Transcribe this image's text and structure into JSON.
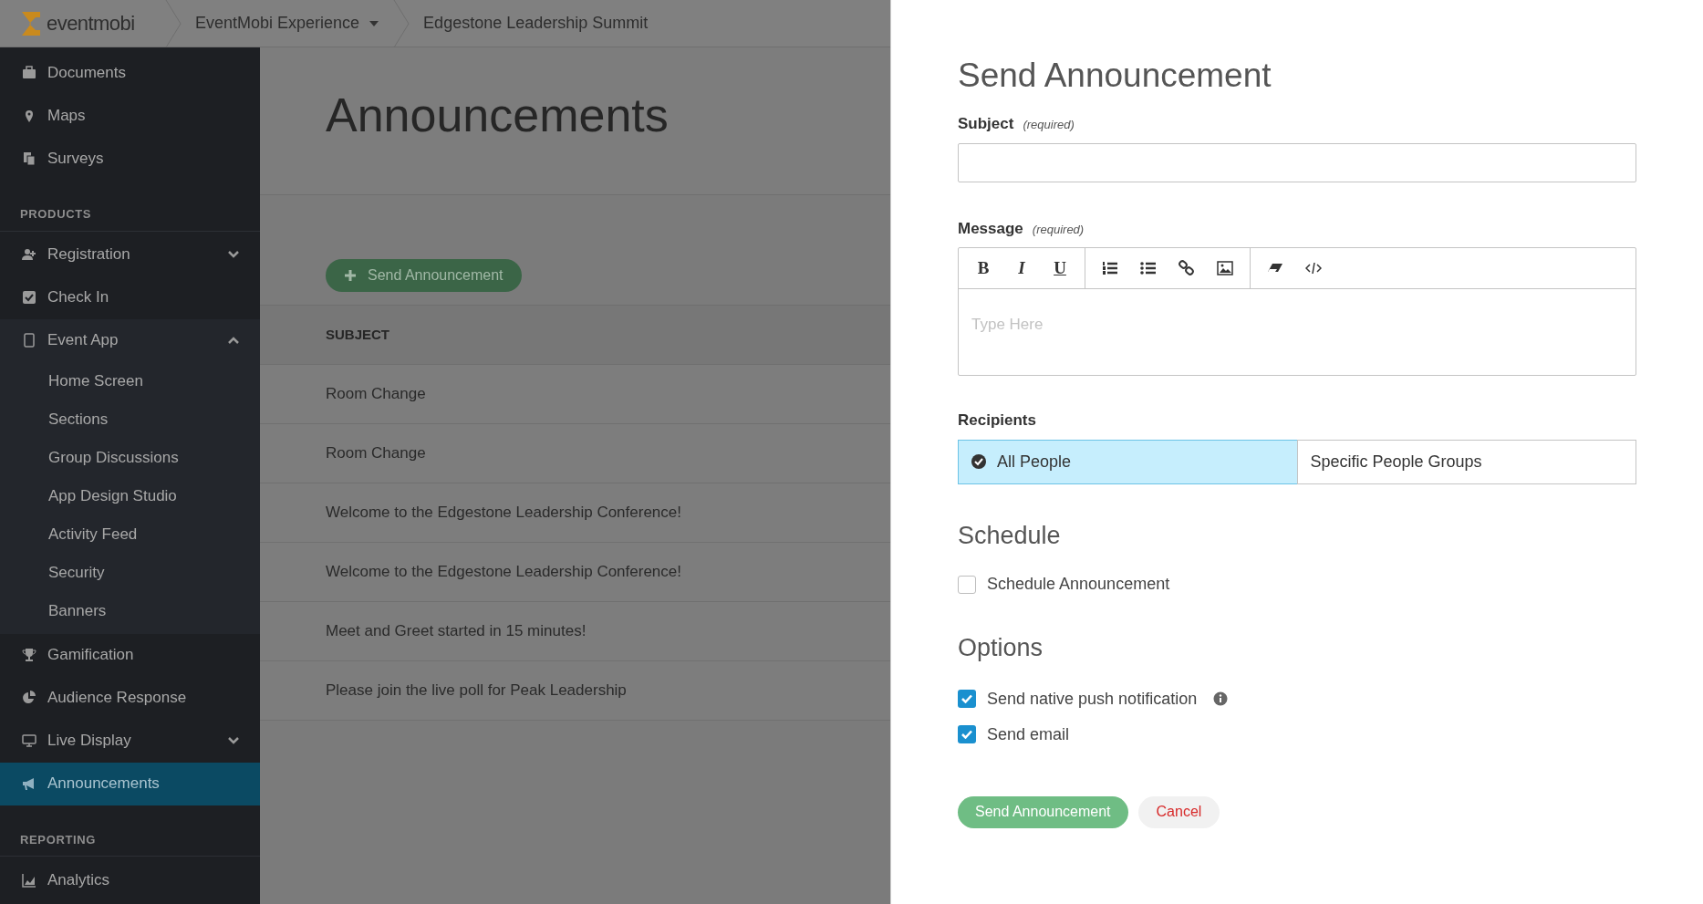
{
  "header": {
    "logo_text": "eventmobi",
    "breadcrumbs": [
      {
        "label": "EventMobi Experience",
        "dropdown": true
      },
      {
        "label": "Edgestone Leadership Summit",
        "dropdown": false
      }
    ]
  },
  "sidebar": {
    "items": [
      {
        "kind": "item",
        "label": "Documents",
        "selected": false
      },
      {
        "kind": "item",
        "label": "Maps",
        "selected": false
      },
      {
        "kind": "item",
        "label": "Surveys",
        "selected": false
      },
      {
        "kind": "heading",
        "label": "PRODUCTS"
      },
      {
        "kind": "item",
        "label": "Registration",
        "selected": false,
        "expanded": false
      },
      {
        "kind": "item",
        "label": "Check In",
        "selected": false
      },
      {
        "kind": "item",
        "label": "Event App",
        "selected": false,
        "expanded": true,
        "children": [
          {
            "label": "Home Screen",
            "selected": false
          },
          {
            "label": "Sections",
            "selected": false
          },
          {
            "label": "Group Discussions",
            "selected": false
          },
          {
            "label": "App Design Studio",
            "selected": false
          },
          {
            "label": "Activity Feed",
            "selected": false
          },
          {
            "label": "Security",
            "selected": false
          },
          {
            "label": "Banners",
            "selected": false
          }
        ]
      },
      {
        "kind": "item",
        "label": "Gamification",
        "selected": false
      },
      {
        "kind": "item",
        "label": "Audience Response",
        "selected": false
      },
      {
        "kind": "item",
        "label": "Live Display",
        "selected": false,
        "expanded": false
      },
      {
        "kind": "item",
        "label": "Announcements",
        "selected": true
      },
      {
        "kind": "heading",
        "label": "REPORTING"
      },
      {
        "kind": "item",
        "label": "Analytics",
        "selected": false
      }
    ]
  },
  "main": {
    "title": "Announcements",
    "new_button": "Send Announcement",
    "table": {
      "columns": [
        "SUBJECT"
      ],
      "rows": [
        "Room Change",
        "Room Change",
        "Welcome to the Edgestone Leadership Conference!",
        "Welcome to the Edgestone Leadership Conference!",
        "Meet and Greet started in 15 minutes!",
        "Please join the live poll for Peak Leadership"
      ]
    }
  },
  "panel": {
    "title": "Send Announcement",
    "subject": {
      "label": "Subject",
      "note": "(required)"
    },
    "message": {
      "label": "Message",
      "note": "(required)",
      "placeholder": "Type Here",
      "format_buttons": [
        "B",
        "I",
        "U"
      ]
    },
    "recipients": {
      "label": "Recipients",
      "options": [
        {
          "label": "All People",
          "selected": true
        },
        {
          "label": "Specific People Groups",
          "selected": false
        }
      ]
    },
    "schedule": {
      "heading": "Schedule",
      "checkbox": {
        "label": "Schedule Announcement",
        "checked": false
      }
    },
    "options": {
      "heading": "Options",
      "checkboxes": [
        {
          "label": "Send native push notification",
          "checked": true,
          "info": true
        },
        {
          "label": "Send email",
          "checked": true,
          "info": false
        }
      ]
    },
    "buttons": {
      "submit": "Send Announcement",
      "cancel": "Cancel"
    }
  }
}
